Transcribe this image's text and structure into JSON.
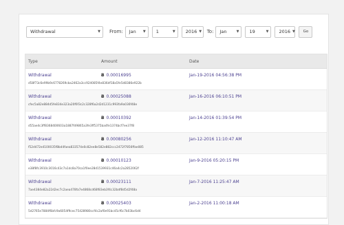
{
  "filters": {
    "type_value": "Withdrawal",
    "from_label": "From:",
    "from_month": "Jan",
    "from_day": "1",
    "from_year": "2016",
    "to_label": "To:",
    "to_month": "Jan",
    "to_day": "19",
    "to_year": "2016",
    "go_label": "Go"
  },
  "table": {
    "headers": {
      "type": "Type",
      "amount": "Amount",
      "date": "Date"
    },
    "currency_symbol": "Ƀ",
    "rows": [
      {
        "type": "Withdrawal",
        "amount": "0.00016995",
        "date": "Jan-19-2016 04:56:38 PM",
        "hash": "d58f73c6e99b9c6778269cba2462a3cc924085f4e836df18a5fe5d8386e922b"
      },
      {
        "type": "Withdrawal",
        "amount": "0.00025088",
        "date": "Jan-16-2016 06:10:51 PM",
        "hash": "cfec5a82e884d5fe834e323a20f6f3c2c328f6a2d2d1231c993fa9a036f48e"
      },
      {
        "type": "Withdrawal",
        "amount": "0.00010392",
        "date": "Jan-14-2016 01:39:54 PM",
        "hash": "d55ae4c3ff8368400603a1887fd9865a3fe3ff5375ba4fe1374bcf7ee37f8"
      },
      {
        "type": "Withdrawal",
        "amount": "0.00080256",
        "date": "Jan-12-2016 11:10:47 AM",
        "hash": "f52d472e4100035f8bd4faea833574e0c82ee8e582e882ccc2472f7856ffae085"
      },
      {
        "type": "Withdrawal",
        "amount": "0.00010123",
        "date": "Jan-9-2016 05:20:15 PM",
        "hash": "e38f8fc3910c3016c43c7a1dc8a70ca1f0ee28d1539931c46a4c2a2852062f"
      },
      {
        "type": "Withdrawal",
        "amount": "0.00023111",
        "date": "Jan-7-2016 11:25:47 AM",
        "hash": "7ae4384e82a22d2ec7c2aea478fa7e4868cd68f83eb3f4c32bdf8d5d2f48a"
      },
      {
        "type": "Withdrawal",
        "amount": "0.00025403",
        "date": "Jan-2-2016 11:00:18 AM",
        "hash": "5d2765e7884f6bfc9a6054f9cec75428980ccf4c2af0e91bc45cf6c7b03bc6d4"
      }
    ]
  }
}
